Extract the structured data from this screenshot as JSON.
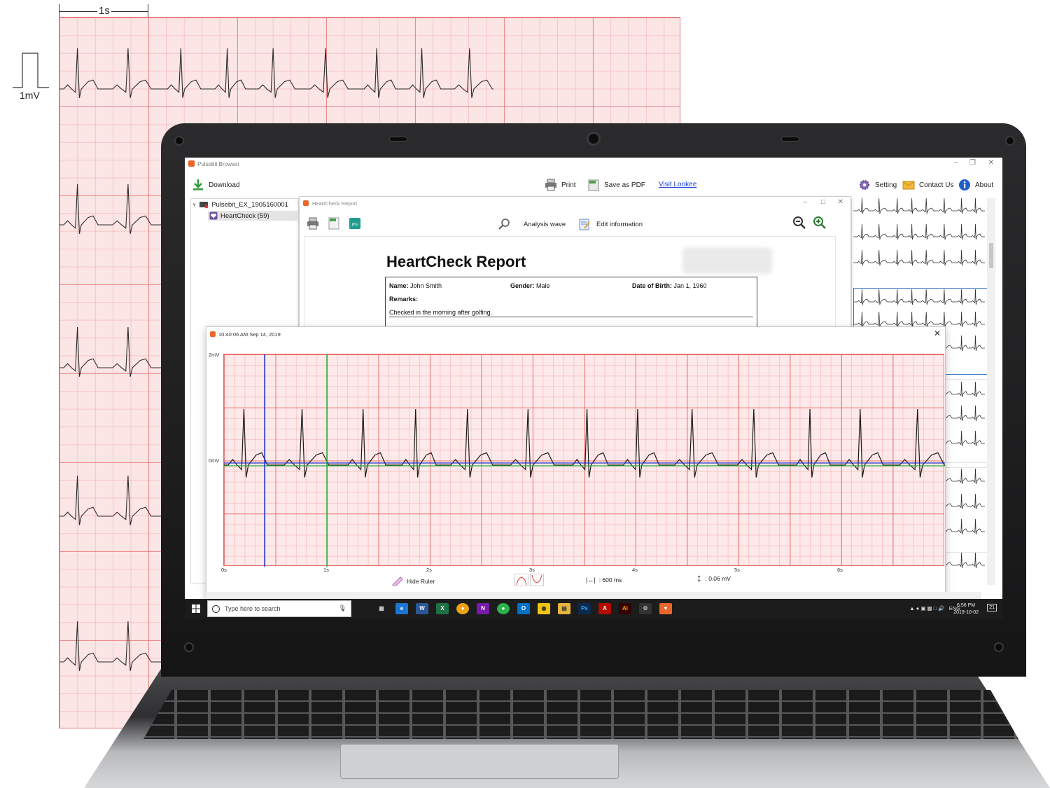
{
  "background_strip": {
    "scale_time_label": "1s",
    "scale_volt_label": "1mV"
  },
  "window": {
    "title": "Pulsebit Browser"
  },
  "toolbar": {
    "download_label": "Download",
    "print_label": "Print",
    "save_pdf_label": "Save as PDF",
    "visit_link_label": "Visit Lookee",
    "setting_label": "Setting",
    "contact_label": "Contact Us",
    "about_label": "About"
  },
  "tree": {
    "device_label": "Pulsebit_EX_1905160001",
    "heartcheck_label": "HeartCheck  (59)"
  },
  "report": {
    "window_title": "HeartCheck Report",
    "analysis_label": "Analysis wave",
    "edit_label": "Edit information",
    "heading": "HeartCheck Report",
    "name_key": "Name:",
    "name_value": "John Smith",
    "gender_key": "Gender:",
    "gender_value": "Male",
    "dob_key": "Date of Birth:",
    "dob_value": "Jan 1, 1960",
    "remarks_key": "Remarks:",
    "remarks_value": "Checked in the morning after golfing."
  },
  "ecg_window": {
    "title": "10:40:06 AM Sep 14, 2019",
    "y_labels": [
      "2mV",
      "0mV"
    ],
    "x_labels": [
      "0s",
      "1s",
      "2s",
      "3s",
      "4s",
      "5s",
      "6s"
    ],
    "hide_ruler_label": "Hide Ruler",
    "interval_readout": ": 600 ms",
    "amplitude_readout": ": 0.06 mV"
  },
  "taskbar": {
    "search_placeholder": "Type here to search",
    "tray_lang": "ENG",
    "clock_time": "6:56 PM",
    "clock_date": "2019-10-02",
    "notif_count": "21"
  },
  "colors": {
    "ecg_trace": "#1a1a1a",
    "ruler_blue": "#1f34c9",
    "ruler_green": "#2aa838",
    "grid_major": "#e36c6c",
    "brand_orange": "#e8662a"
  }
}
